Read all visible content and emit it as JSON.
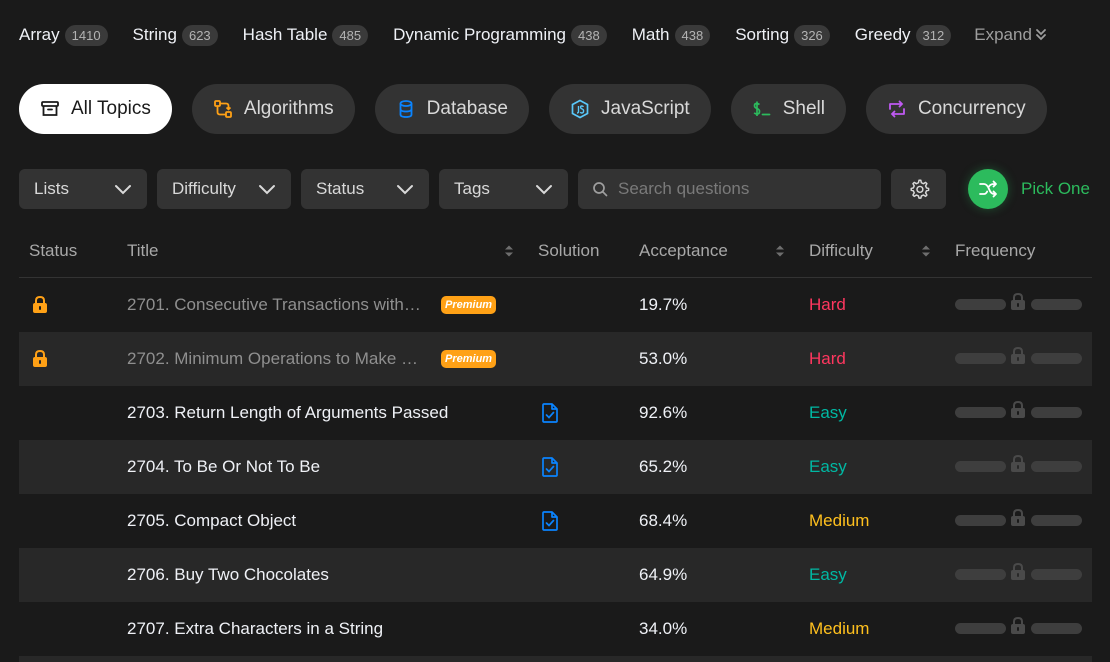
{
  "tags": [
    {
      "name": "Array",
      "count": "1410"
    },
    {
      "name": "String",
      "count": "623"
    },
    {
      "name": "Hash Table",
      "count": "485"
    },
    {
      "name": "Dynamic Programming",
      "count": "438"
    },
    {
      "name": "Math",
      "count": "438"
    },
    {
      "name": "Sorting",
      "count": "326"
    },
    {
      "name": "Greedy",
      "count": "312"
    }
  ],
  "expand_label": "Expand",
  "topics": [
    {
      "label": "All Topics",
      "icon": "stack-icon",
      "active": true
    },
    {
      "label": "Algorithms",
      "icon": "algorithm-icon",
      "color": "#ffa116"
    },
    {
      "label": "Database",
      "icon": "database-icon",
      "color": "#0a84ff"
    },
    {
      "label": "JavaScript",
      "icon": "javascript-icon",
      "color": "#5ac8fa"
    },
    {
      "label": "Shell",
      "icon": "shell-icon",
      "color": "#2cbb5d"
    },
    {
      "label": "Concurrency",
      "icon": "concurrency-icon",
      "color": "#bf5af2"
    }
  ],
  "filters": {
    "lists": "Lists",
    "difficulty": "Difficulty",
    "status": "Status",
    "tags": "Tags",
    "search_placeholder": "Search questions",
    "pick_one": "Pick One"
  },
  "columns": {
    "status": "Status",
    "title": "Title",
    "solution": "Solution",
    "acceptance": "Acceptance",
    "difficulty": "Difficulty",
    "frequency": "Frequency"
  },
  "premium_label": "Premium",
  "rows": [
    {
      "title": "2701. Consecutive Transactions with…",
      "locked": true,
      "premium": true,
      "solution": false,
      "acceptance": "19.7%",
      "difficulty": "Hard"
    },
    {
      "title": "2702. Minimum Operations to Make …",
      "locked": true,
      "premium": true,
      "solution": false,
      "acceptance": "53.0%",
      "difficulty": "Hard"
    },
    {
      "title": "2703. Return Length of Arguments Passed",
      "locked": false,
      "premium": false,
      "solution": true,
      "acceptance": "92.6%",
      "difficulty": "Easy"
    },
    {
      "title": "2704. To Be Or Not To Be",
      "locked": false,
      "premium": false,
      "solution": true,
      "acceptance": "65.2%",
      "difficulty": "Easy"
    },
    {
      "title": "2705. Compact Object",
      "locked": false,
      "premium": false,
      "solution": true,
      "acceptance": "68.4%",
      "difficulty": "Medium"
    },
    {
      "title": "2706. Buy Two Chocolates",
      "locked": false,
      "premium": false,
      "solution": false,
      "acceptance": "64.9%",
      "difficulty": "Easy"
    },
    {
      "title": "2707. Extra Characters in a String",
      "locked": false,
      "premium": false,
      "solution": false,
      "acceptance": "34.0%",
      "difficulty": "Medium"
    }
  ],
  "difficulty_colors": {
    "Easy": "#00b8a3",
    "Medium": "#ffc01e",
    "Hard": "#ff375f"
  },
  "colors": {
    "accent_green": "#2cbb5d",
    "premium": "#ffa116",
    "lock": "#ffa116",
    "solution_icon": "#0a84ff"
  }
}
